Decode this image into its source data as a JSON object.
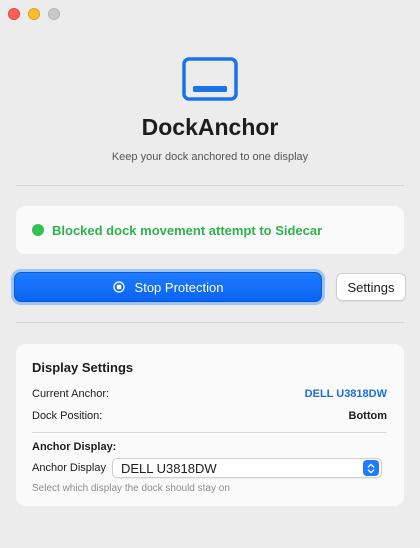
{
  "window": {
    "controls": [
      "close",
      "minimize",
      "zoom"
    ]
  },
  "header": {
    "icon": "dock-display-icon",
    "title": "DockAnchor",
    "subtitle": "Keep your dock anchored to one display"
  },
  "status": {
    "text": "Blocked dock movement attempt to Sidecar",
    "color": "#30c152"
  },
  "actions": {
    "stop_label": "Stop Protection",
    "settings_label": "Settings",
    "accent": "#0a63f2"
  },
  "display_settings": {
    "title": "Display Settings",
    "current_anchor_label": "Current Anchor:",
    "current_anchor_value": "DELL U3818DW",
    "dock_position_label": "Dock Position:",
    "dock_position_value": "Bottom",
    "anchor_display_heading": "Anchor Display:",
    "anchor_display_label": "Anchor Display",
    "anchor_display_selected": "DELL U3818DW",
    "hint": "Select which display the dock should stay on"
  }
}
